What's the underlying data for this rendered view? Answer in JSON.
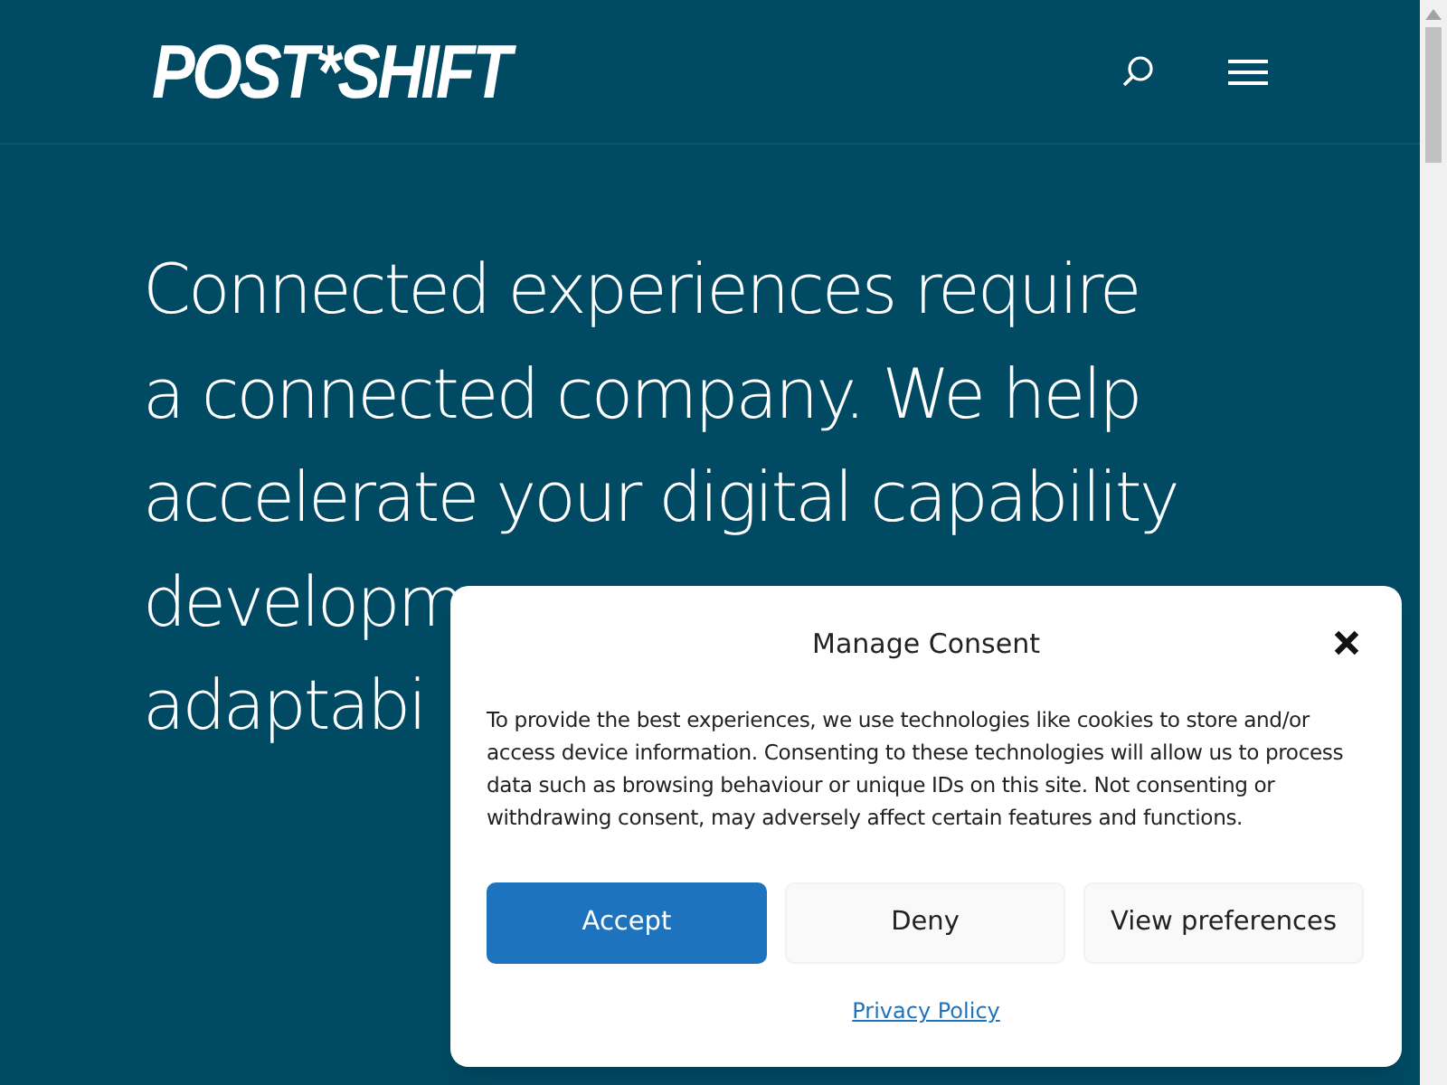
{
  "header": {
    "logo": "POST*SHIFT"
  },
  "hero": {
    "lines": [
      "Connected experiences require",
      "a connected company. We help",
      "accelerate your digital capability",
      "developm",
      "adaptabi"
    ]
  },
  "consent": {
    "title": "Manage Consent",
    "body": "To provide the best experiences, we use technologies like cookies to store and/or access device information. Consenting to these technologies will allow us to process data such as browsing behaviour or unique IDs on this site. Not consenting or withdrawing consent, may adversely affect certain features and functions.",
    "buttons": [
      {
        "label": "Accept",
        "kind": "primary"
      },
      {
        "label": "Deny",
        "kind": "secondary"
      },
      {
        "label": "View preferences",
        "kind": "secondary"
      }
    ],
    "link": "Privacy Policy"
  }
}
